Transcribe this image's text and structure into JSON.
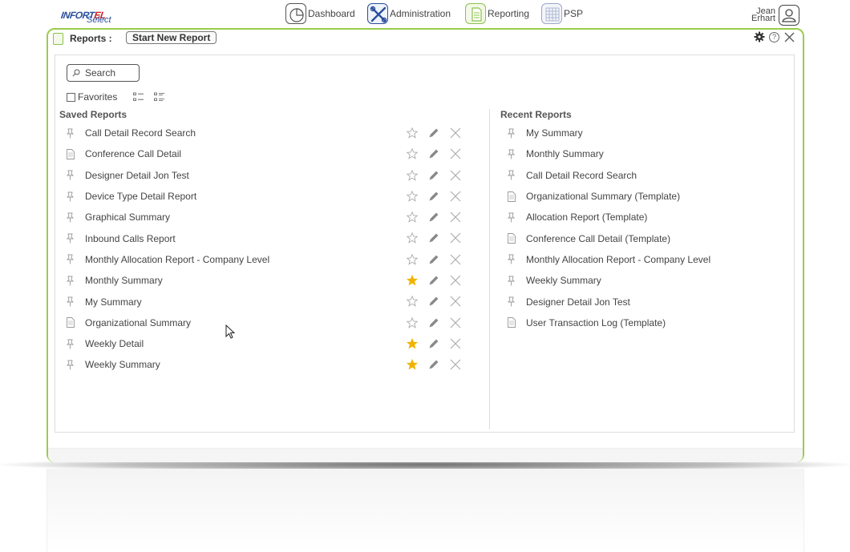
{
  "app": {
    "logo_brand_prefix": "INFORT",
    "logo_brand_accent": "EL",
    "logo_sub": "Select"
  },
  "nav": {
    "items": [
      {
        "label": "Dashboard",
        "icon": "dashboard-pie-icon"
      },
      {
        "label": "Administration",
        "icon": "tools-icon"
      },
      {
        "label": "Reporting",
        "icon": "document-icon"
      },
      {
        "label": "PSP",
        "icon": "grid-icon"
      }
    ]
  },
  "user": {
    "first_name": "Jean",
    "last_name": "Erhart",
    "icon": "user-icon"
  },
  "window": {
    "title": "Reports :",
    "start_button": "Start New Report",
    "tool_icons": [
      "gear-icon",
      "help-icon",
      "close-icon"
    ],
    "help_glyph": "?"
  },
  "toolbar": {
    "search_placeholder": "Search",
    "favorites_label": "Favorites",
    "favorites_checked": false
  },
  "saved_reports": {
    "title": "Saved Reports",
    "items": [
      {
        "name": "Call Detail Record Search",
        "type": "pin",
        "favorite": false
      },
      {
        "name": "Conference Call Detail",
        "type": "doc",
        "favorite": false
      },
      {
        "name": "Designer Detail Jon Test",
        "type": "pin",
        "favorite": false
      },
      {
        "name": "Device Type Detail Report",
        "type": "pin",
        "favorite": false
      },
      {
        "name": "Graphical Summary",
        "type": "pin",
        "favorite": false
      },
      {
        "name": "Inbound Calls Report",
        "type": "pin",
        "favorite": false
      },
      {
        "name": "Monthly Allocation Report - Company Level",
        "type": "pin",
        "favorite": false
      },
      {
        "name": "Monthly Summary",
        "type": "pin",
        "favorite": true
      },
      {
        "name": "My Summary",
        "type": "pin",
        "favorite": false
      },
      {
        "name": "Organizational Summary",
        "type": "doc",
        "favorite": false
      },
      {
        "name": "Weekly Detail",
        "type": "pin",
        "favorite": true
      },
      {
        "name": "Weekly Summary",
        "type": "pin",
        "favorite": true
      }
    ]
  },
  "recent_reports": {
    "title": "Recent Reports",
    "items": [
      {
        "name": "My Summary",
        "type": "pin"
      },
      {
        "name": "Monthly Summary",
        "type": "pin"
      },
      {
        "name": "Call Detail Record Search",
        "type": "pin"
      },
      {
        "name": "Organizational Summary (Template)",
        "type": "doc"
      },
      {
        "name": "Allocation Report (Template)",
        "type": "pin"
      },
      {
        "name": "Conference Call Detail (Template)",
        "type": "doc"
      },
      {
        "name": "Monthly Allocation Report - Company Level",
        "type": "pin"
      },
      {
        "name": "Weekly Summary",
        "type": "pin"
      },
      {
        "name": "Designer Detail Jon Test",
        "type": "pin"
      },
      {
        "name": "User Transaction Log (Template)",
        "type": "doc"
      }
    ]
  },
  "colors": {
    "accent_green": "#9bcc4c",
    "star_gold": "#f0b400",
    "icon_gray": "#999999"
  }
}
